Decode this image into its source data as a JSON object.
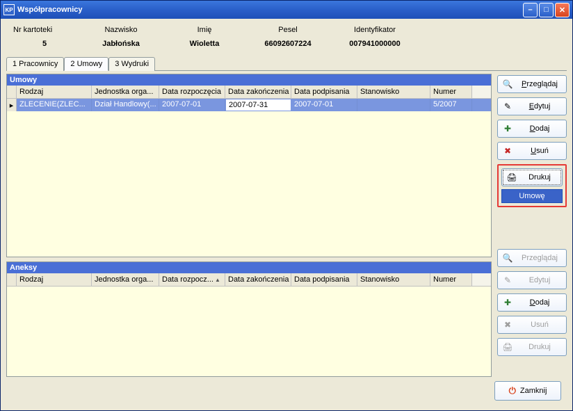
{
  "window_title": "Współpracownicy",
  "header": {
    "labels": {
      "nr": "Nr kartoteki",
      "nazwisko": "Nazwisko",
      "imie": "Imię",
      "pesel": "Pesel",
      "ident": "Identyfikator"
    },
    "values": {
      "nr": "5",
      "nazwisko": "Jabłońska",
      "imie": "Wioletta",
      "pesel": "66092607224",
      "ident": "007941000000"
    }
  },
  "tabs": [
    "1 Pracownicy",
    "2 Umowy",
    "3 Wydruki"
  ],
  "active_tab": 1,
  "umowy": {
    "title": "Umowy",
    "columns": [
      "Rodzaj",
      "Jednostka orga...",
      "Data rozpoczęcia",
      "Data zakończenia",
      "Data podpisania",
      "Stanowisko",
      "Numer"
    ],
    "rows": [
      {
        "rodzaj": "ZLECENIE(ZLEC...",
        "jedn": "Dział Handlowy(...",
        "dr": "2007-07-01",
        "dz": "2007-07-31",
        "dp": "2007-07-01",
        "stan": "",
        "num": "5/2007"
      }
    ]
  },
  "aneksy": {
    "title": "Aneksy",
    "columns": [
      "Rodzaj",
      "Jednostka orga...",
      "Data rozpocz...",
      "Data zakończenia",
      "Data podpisania",
      "Stanowisko",
      "Numer"
    ]
  },
  "buttons": {
    "przegladaj": "Przeglądaj",
    "edytuj": "Edytuj",
    "dodaj": "Dodaj",
    "usun": "Usuń",
    "drukuj": "Drukuj",
    "umowe": "Umowę",
    "zamknij": "Zamknij"
  },
  "colors": {
    "titlebar": "#2A5FC9",
    "panel_header": "#4A6FD6",
    "selected_row": "#7A96DF",
    "highlight_border": "#E53935"
  }
}
